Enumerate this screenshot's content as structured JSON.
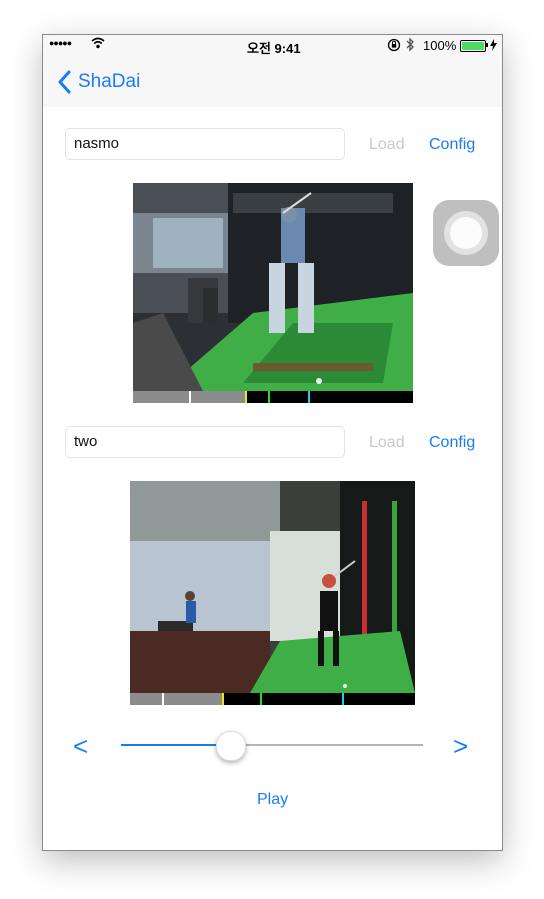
{
  "status_bar": {
    "signal_dots": "●●●●●",
    "time": "오전 9:41",
    "battery_percent": "100%",
    "battery_level": 1.0
  },
  "nav": {
    "back_label": "ShaDai"
  },
  "players": [
    {
      "name_value": "nasmo",
      "load_label": "Load",
      "config_label": "Config"
    },
    {
      "name_value": "two",
      "load_label": "Load",
      "config_label": "Config"
    }
  ],
  "controls": {
    "prev_glyph": "<",
    "next_glyph": ">",
    "slider_value": 0.36,
    "play_label": "Play"
  },
  "colors": {
    "accent": "#1a7cf5",
    "disabled_text": "#c9c9c9",
    "battery": "#4cd964"
  }
}
